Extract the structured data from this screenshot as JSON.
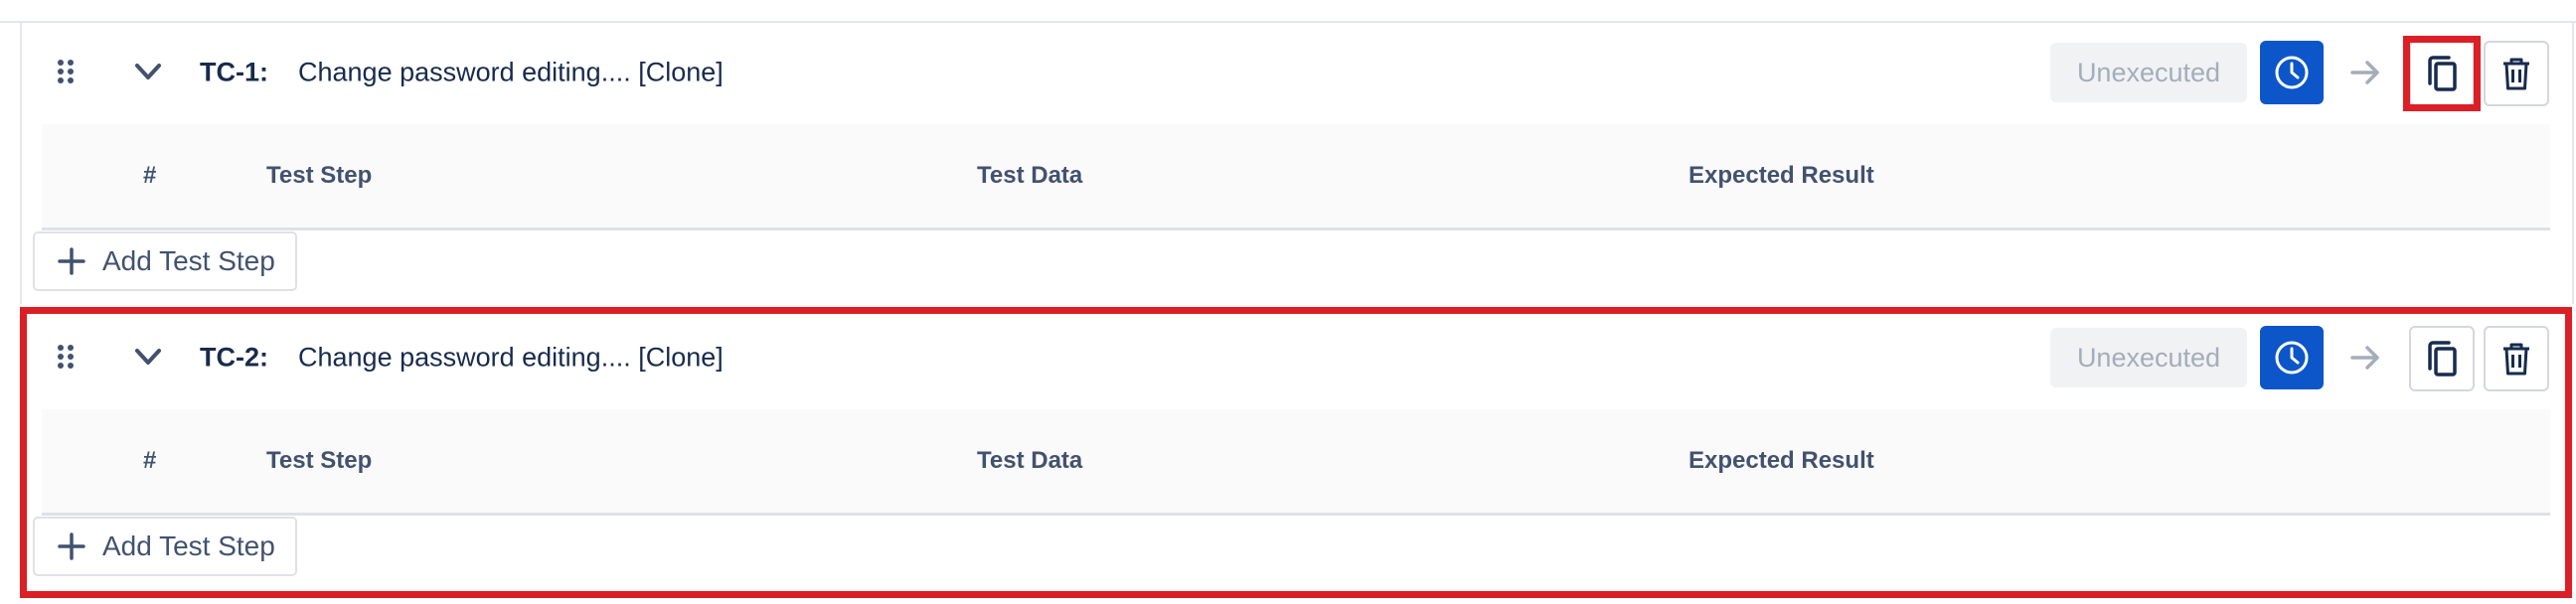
{
  "test_cases": [
    {
      "key": "TC-1:",
      "title": "Change password editing.... [Clone]",
      "status": "Unexecuted",
      "columns": {
        "num": "#",
        "step": "Test Step",
        "data": "Test Data",
        "expected": "Expected Result"
      },
      "add_step_label": "Add Test Step"
    },
    {
      "key": "TC-2:",
      "title": "Change password editing.... [Clone]",
      "status": "Unexecuted",
      "columns": {
        "num": "#",
        "step": "Test Step",
        "data": "Test Data",
        "expected": "Expected Result"
      },
      "add_step_label": "Add Test Step"
    }
  ],
  "colors": {
    "accent": "#0c56c9",
    "highlight": "#dc1f26",
    "text": "#172b4d",
    "muted_text": "#42526e"
  },
  "icons": [
    "drag-handle-icon",
    "chevron-down-icon",
    "clock-icon",
    "arrow-right-icon",
    "clone-icon",
    "trash-icon",
    "plus-icon"
  ]
}
